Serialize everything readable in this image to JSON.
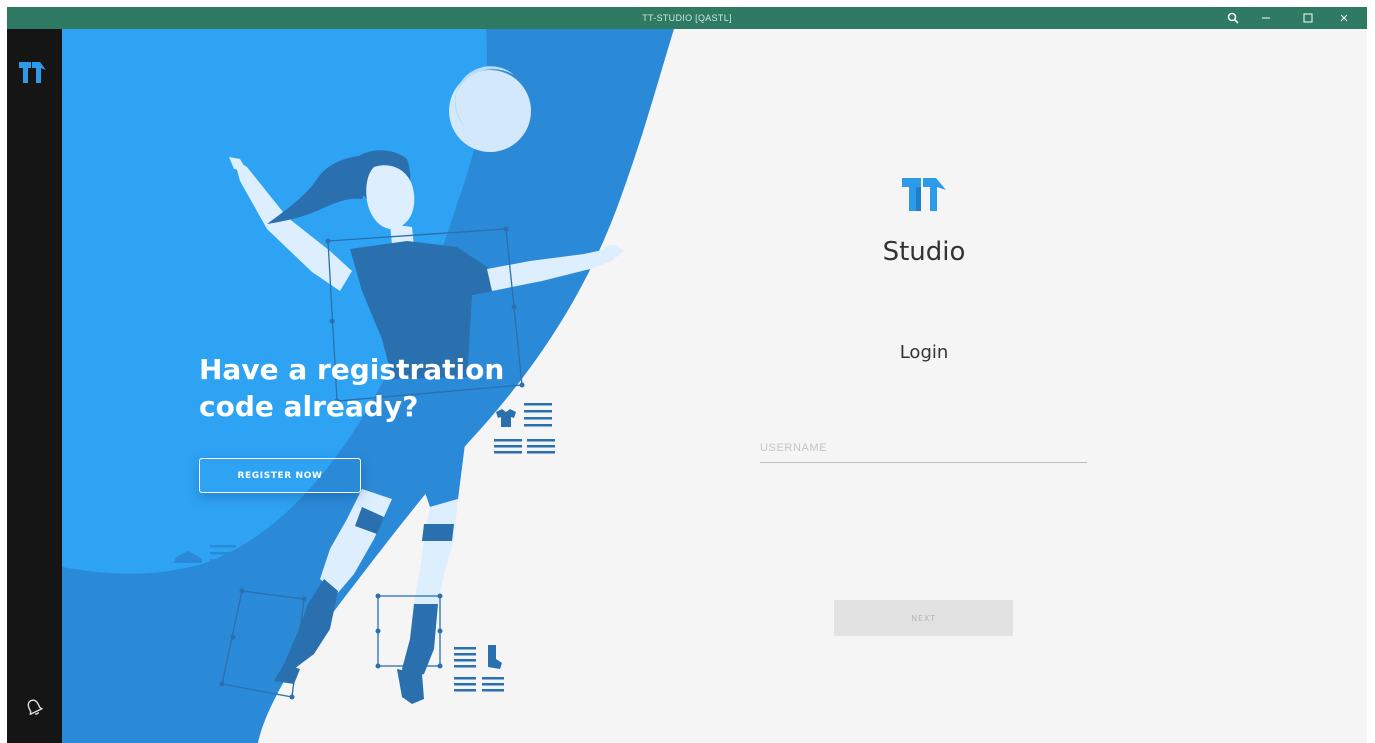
{
  "window": {
    "title": "TT-STUDIO [QASTL]"
  },
  "titlebar_controls": {
    "icons": [
      "search-icon",
      "minimize-icon",
      "maximize-icon",
      "close-icon"
    ]
  },
  "sidebar": {
    "icons": [
      "tt-logo-icon",
      "bell-icon"
    ]
  },
  "hero": {
    "heading": "Have a registration\ncode already?",
    "register_label": "REGISTER NOW",
    "illustration": "volleyball-player-illustration"
  },
  "login": {
    "app_name": "Studio",
    "title": "Login",
    "username_placeholder": "USERNAME",
    "username_value": "",
    "next_label": "NEXT"
  },
  "colors": {
    "titlebar": "#2e7a62",
    "sidebar": "#151515",
    "hero_light": "#2ea3f3",
    "hero_dark": "#2b8ad8",
    "figure_navy": "#2a6fae",
    "figure_pale": "#ddeeff",
    "brand_blue": "#2b9bea",
    "login_bg": "#f5f5f5"
  }
}
